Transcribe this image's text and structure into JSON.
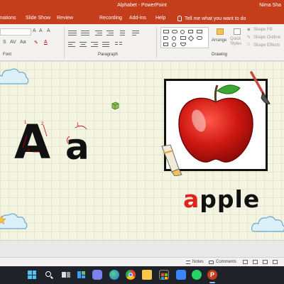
{
  "window": {
    "title": "Alphabet - PowerPoint",
    "user": "Nima Sha"
  },
  "ribbon_tabs": [
    "mations",
    "Slide Show",
    "Review",
    "Recording",
    "Add-ins",
    "Help"
  ],
  "tell_me": "Tell me what you want to do",
  "ribbon": {
    "font_group_label": "Font",
    "paragraph_group_label": "Paragraph",
    "drawing_group_label": "Drawing",
    "arrange_label": "Arrange",
    "quick_styles_label": "Quick\nStyles",
    "shape_fill": "Shape Fill",
    "shape_outline": "Shape Outline",
    "shape_effects": "Shape Effects"
  },
  "slide": {
    "uppercase": "A",
    "lowercase": "a",
    "word_first_letter": "a",
    "word_rest": "pple",
    "stroke_numbers": [
      "1",
      "2",
      "3",
      "1"
    ],
    "image_name": "apple-picture"
  },
  "status": {
    "notes": "Notes",
    "comments": "Comments"
  },
  "colors": {
    "accent": "#c43e1c",
    "highlight_letter": "#e0241c",
    "taskbar": "#1f2329"
  },
  "taskbar_icons": [
    "windows-start-icon",
    "search-icon",
    "task-view-icon",
    "widgets-icon",
    "teams-chat-icon",
    "edge-icon",
    "chrome-icon",
    "file-explorer-icon",
    "store-icon",
    "photos-icon",
    "whatsapp-icon",
    "powerpoint-icon"
  ]
}
